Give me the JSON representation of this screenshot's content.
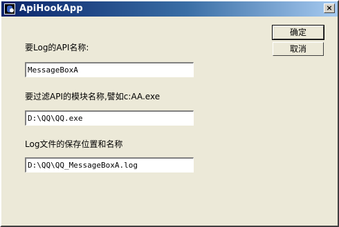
{
  "window": {
    "title": "ApiHookApp",
    "close_symbol": "×",
    "app_icon": "app-icon"
  },
  "form": {
    "api_label": "要Log的API名称:",
    "api_value": "MessageBoxA",
    "module_label": "要过滤API的模块名称,譬如c:AA.exe",
    "module_value": "D:\\QQ\\QQ.exe",
    "logfile_label": "Log文件的保存位置和名称",
    "logfile_value": "D:\\QQ\\QQ_MessageBoxA.log"
  },
  "buttons": {
    "ok_label": "确定",
    "cancel_label": "取消"
  }
}
